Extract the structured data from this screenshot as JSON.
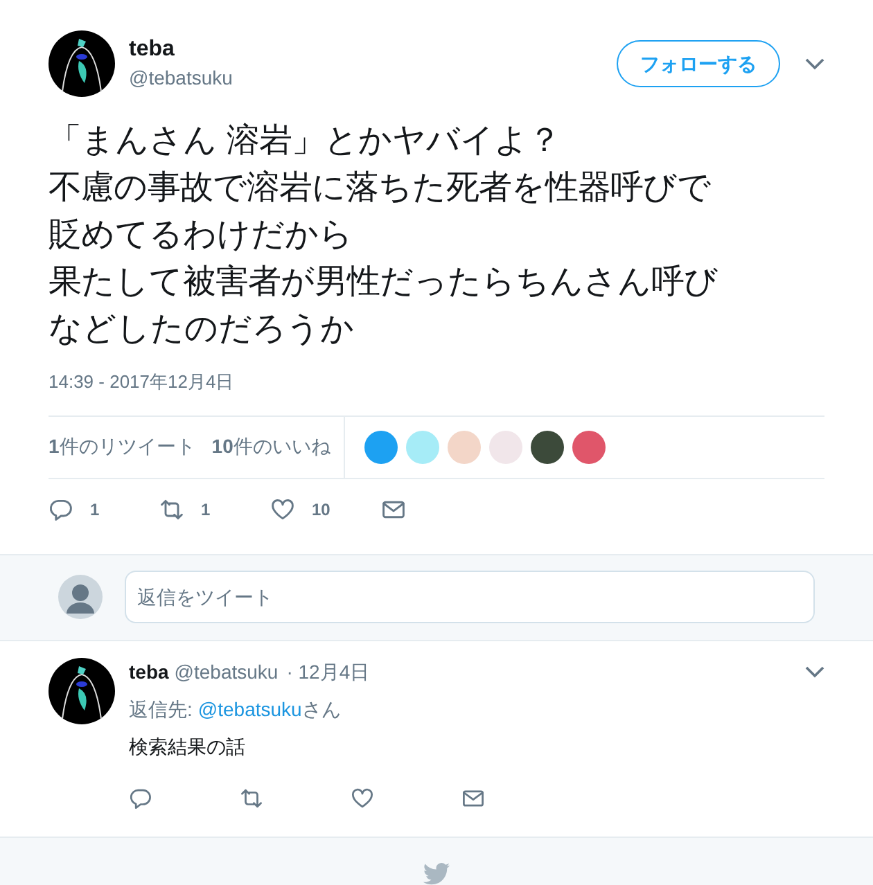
{
  "tweet": {
    "name": "teba",
    "handle": "@tebatsuku",
    "follow_button": "フォローする",
    "text_lines": [
      "「まんさん 溶岩」とかヤバイよ？",
      "不慮の事故で溶岩に落ちた死者を性器呼びで",
      "貶めてるわけだから",
      "果たして被害者が男性だったらちんさん呼び",
      "などしたのだろうか"
    ],
    "timestamp": "14:39 - 2017年12月4日",
    "stats": [
      "**1**件のリツイート",
      "**10**件のいいね"
    ],
    "likers": [
      {
        "color": "#1da1f2"
      },
      {
        "color": "#a6ecf7"
      },
      {
        "color": "#f3d6c8"
      },
      {
        "color": "#f1e6ea"
      },
      {
        "color": "#3c4a3a"
      },
      {
        "color": "#e0566a"
      }
    ],
    "actions": [
      {
        "kind": "reply",
        "count": "1"
      },
      {
        "kind": "retweet",
        "count": "1"
      },
      {
        "kind": "like",
        "count": "10"
      },
      {
        "kind": "dm"
      }
    ]
  },
  "reply_box": {
    "placeholder": "返信をツイート"
  },
  "replies": [
    {
      "name": "teba",
      "handle": "@tebatsuku",
      "date": "· 12月4日",
      "reply_to_label": "返信先:",
      "reply_to_link": "@tebatsuku",
      "reply_to_suffix": "さん",
      "text": "検索結果の話",
      "actions": [
        {
          "kind": "reply"
        },
        {
          "kind": "retweet"
        },
        {
          "kind": "like"
        },
        {
          "kind": "dm"
        }
      ]
    }
  ]
}
